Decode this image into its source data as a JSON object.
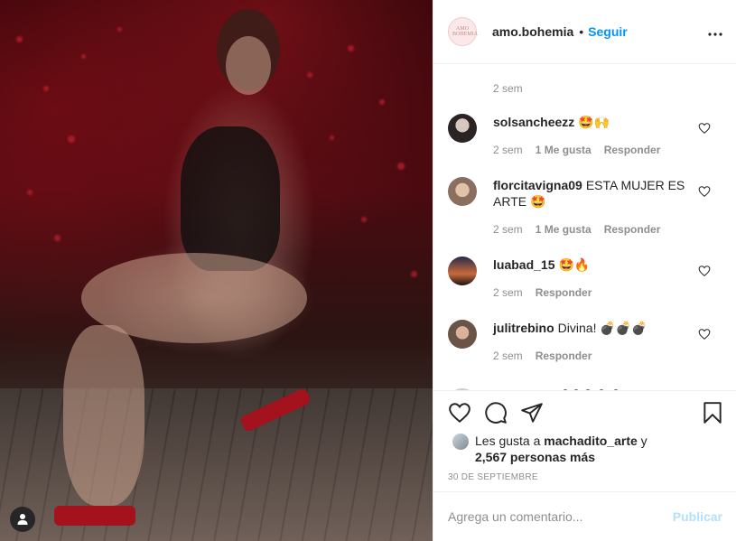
{
  "post": {
    "author": "amo.bohemia",
    "avatar_text": "AMO BOHEMIA",
    "separator": "•",
    "follow_label": "Seguir",
    "more_label": "•••",
    "caption_time": "2 sem",
    "photo_alt": "Post photo"
  },
  "comments": [
    {
      "user": "solsancheezz",
      "text": "🤩🙌",
      "time": "2 sem",
      "likes": "1 Me gusta",
      "reply": "Responder"
    },
    {
      "user": "florcitavigna09",
      "text": "ESTA MUJER ES ARTE 🤩",
      "time": "2 sem",
      "likes": "1 Me gusta",
      "reply": "Responder"
    },
    {
      "user": "luabad_15",
      "text": "🤩🔥",
      "time": "2 sem",
      "likes": "",
      "reply": "Responder"
    },
    {
      "user": "julitrebino",
      "text": "Divina! 💣💣💣",
      "time": "2 sem",
      "likes": "",
      "reply": "Responder"
    }
  ],
  "likes": {
    "prefix": "Les gusta a ",
    "user": "machadito_arte",
    "middle": " y",
    "count": "2,567 personas más"
  },
  "date": "30 DE SEPTIEMBRE",
  "add_comment": {
    "placeholder": "Agrega un comentario...",
    "publish_label": "Publicar"
  },
  "colors": {
    "accent": "#0095f6",
    "publish_disabled": "#b2dffc",
    "muted": "#8e8e8e",
    "text": "#262626"
  }
}
